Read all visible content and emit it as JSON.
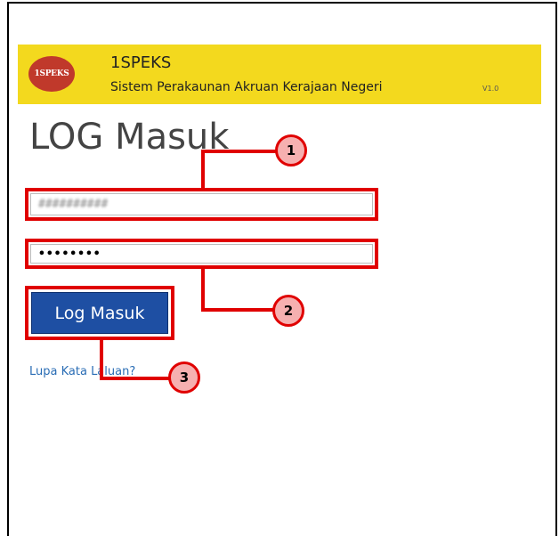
{
  "header": {
    "logo_text": "1SPEKS",
    "app_name": "1SPEKS",
    "app_subtitle": "Sistem Perakaunan Akruan Kerajaan Negeri",
    "version": "V1.0"
  },
  "page_title": "LOG Masuk",
  "form": {
    "username_value": "##########",
    "password_value": "••••••••",
    "submit_label": "Log Masuk",
    "forgot_link": "Lupa Kata Laluan?"
  },
  "callouts": [
    "1",
    "2",
    "3"
  ],
  "colors": {
    "header_bg": "#f3d91e",
    "button_bg": "#1e4fa3",
    "callout_red": "#e00000",
    "badge_fill": "#f6b0b0",
    "link": "#2a6db5"
  }
}
